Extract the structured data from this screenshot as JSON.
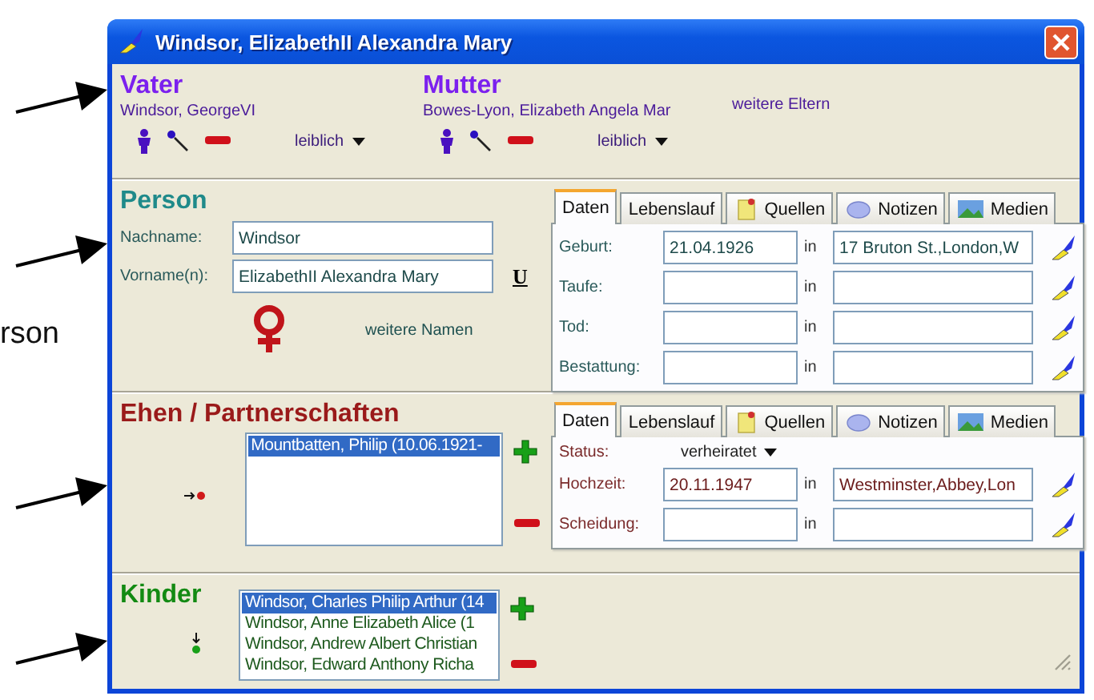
{
  "annotation_text": "rson",
  "window": {
    "title": "Windsor, ElizabethII Alexandra Mary"
  },
  "parents": {
    "father": {
      "heading": "Vater",
      "name": "Windsor, GeorgeVI",
      "relation": "leiblich"
    },
    "mother": {
      "heading": "Mutter",
      "name": "Bowes-Lyon, Elizabeth Angela Mar",
      "relation": "leiblich"
    },
    "more_link": "weitere Eltern"
  },
  "person": {
    "heading": "Person",
    "fields": [
      {
        "label": "Nachname:",
        "value": "Windsor"
      },
      {
        "label": "Vorname(n):",
        "value": "ElizabethII Alexandra Mary"
      }
    ],
    "u_button": "U",
    "more_names": "weitere Namen",
    "tabs": [
      {
        "label": "Daten",
        "selected": true
      },
      {
        "label": "Lebenslauf",
        "selected": false
      },
      {
        "label": "Quellen",
        "selected": false
      },
      {
        "label": "Notizen",
        "selected": false
      },
      {
        "label": "Medien",
        "selected": false
      }
    ],
    "events": [
      {
        "label": "Geburt:",
        "date": "21.04.1926",
        "in": "in",
        "place": "17 Bruton St.,London,W"
      },
      {
        "label": "Taufe:",
        "in": "in"
      },
      {
        "label": "Tod:",
        "in": "in"
      },
      {
        "label": "Bestattung:",
        "in": "in"
      }
    ]
  },
  "partnerships": {
    "heading": "Ehen / Partnerschaften",
    "items": [
      {
        "text": "Mountbatten, Philip (10.06.1921-",
        "selected": true
      }
    ],
    "tabs": [
      {
        "label": "Daten",
        "selected": true
      },
      {
        "label": "Lebenslauf",
        "selected": false
      },
      {
        "label": "Quellen",
        "selected": false
      },
      {
        "label": "Notizen",
        "selected": false
      },
      {
        "label": "Medien",
        "selected": false
      }
    ],
    "status_label": "Status:",
    "status_value": "verheiratet",
    "events": [
      {
        "label": "Hochzeit:",
        "date": "20.11.1947",
        "in": "in",
        "place": "Westminster,Abbey,Lon"
      },
      {
        "label": "Scheidung:",
        "in": "in"
      }
    ]
  },
  "children": {
    "heading": "Kinder",
    "items": [
      {
        "text": "Windsor, Charles Philip Arthur (14",
        "selected": true
      },
      {
        "text": "Windsor, Anne Elizabeth Alice (1",
        "selected": false
      },
      {
        "text": "Windsor, Andrew Albert Christian",
        "selected": false
      },
      {
        "text": "Windsor, Edward Anthony Richa",
        "selected": false
      }
    ]
  }
}
